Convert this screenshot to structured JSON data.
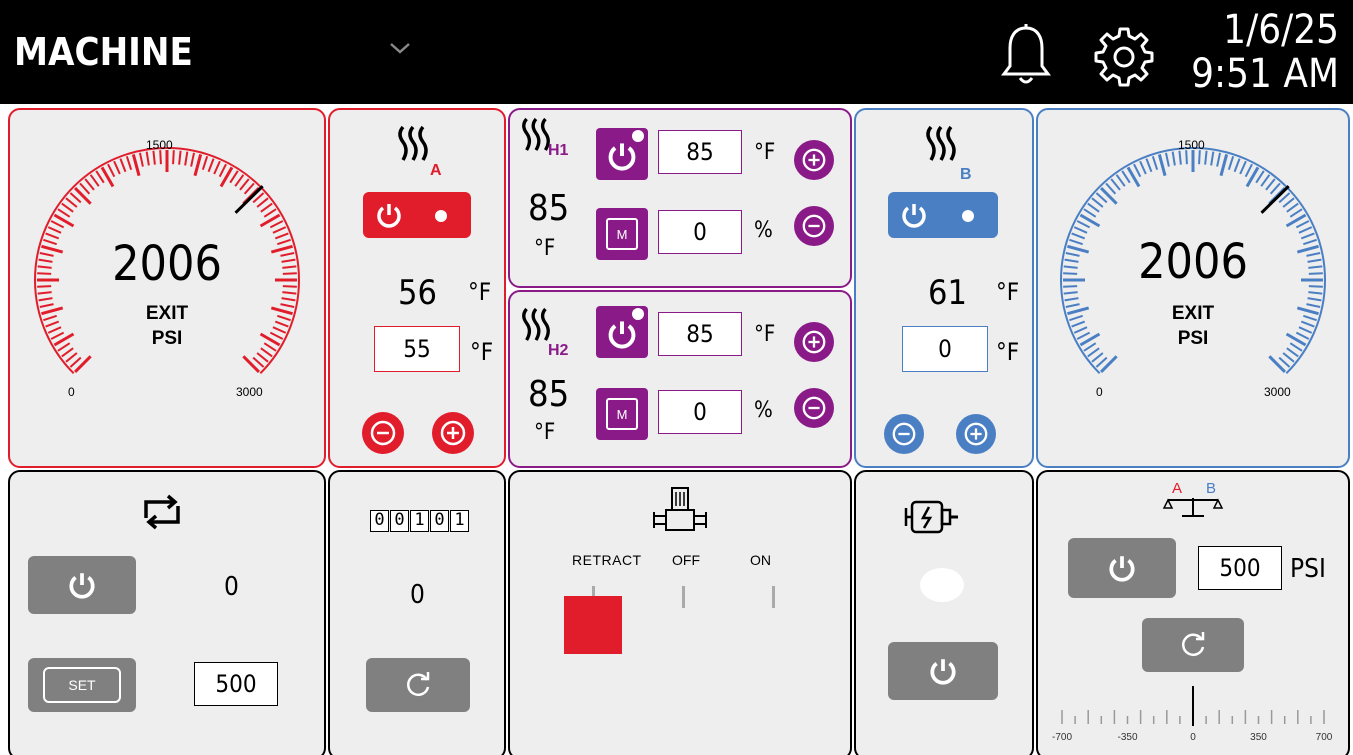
{
  "header": {
    "title": "MACHINE",
    "date": "1/6/25",
    "time": "9:51 AM",
    "icons": [
      "chevron-down-icon",
      "bell-icon",
      "gear-icon"
    ]
  },
  "gauge_a": {
    "value": "2006",
    "label1": "EXIT",
    "label2": "PSI",
    "tick_min": "0",
    "tick_mid": "1500",
    "tick_max": "3000",
    "color": "#e11d2c"
  },
  "gauge_b": {
    "value": "2006",
    "label1": "EXIT",
    "label2": "PSI",
    "tick_min": "0",
    "tick_mid": "1500",
    "tick_max": "3000",
    "color": "#4a7fc4"
  },
  "heater_a": {
    "sub": "A",
    "temp": "56",
    "unit": "°F",
    "setpoint": "55",
    "set_unit": "°F",
    "color": "#e11d2c"
  },
  "heater_b": {
    "sub": "B",
    "temp": "61",
    "unit": "°F",
    "setpoint": "0",
    "set_unit": "°F",
    "color": "#4a7fc4"
  },
  "hose_h1": {
    "sub": "H1",
    "temp": "85",
    "temp_unit": "°F",
    "setpoint": "85",
    "set_unit": "°F",
    "percent": "0",
    "pct_unit": "%",
    "manual_label": "M"
  },
  "hose_h2": {
    "sub": "H2",
    "temp": "85",
    "temp_unit": "°F",
    "setpoint": "85",
    "set_unit": "°F",
    "percent": "0",
    "pct_unit": "%",
    "manual_label": "M"
  },
  "recirc": {
    "value": "0",
    "set_label": "SET",
    "set_value": "500"
  },
  "counter": {
    "digits": [
      "0",
      "0",
      "1",
      "0",
      "1"
    ],
    "value": "0"
  },
  "pump": {
    "retract": "RETRACT",
    "off": "OFF",
    "on": "ON",
    "indicator_color": "#e11d2c"
  },
  "motor": {
    "status_color": "#ffffff"
  },
  "balance": {
    "label_a": "A",
    "label_b": "B",
    "setpoint": "500",
    "unit": "PSI",
    "scale": [
      "-700",
      "-350",
      "0",
      "350",
      "700"
    ],
    "needle_value": 0
  },
  "colors": {
    "red": "#e11d2c",
    "purple": "#8a1a88",
    "blue": "#4a7fc4",
    "grey": "#808080"
  }
}
